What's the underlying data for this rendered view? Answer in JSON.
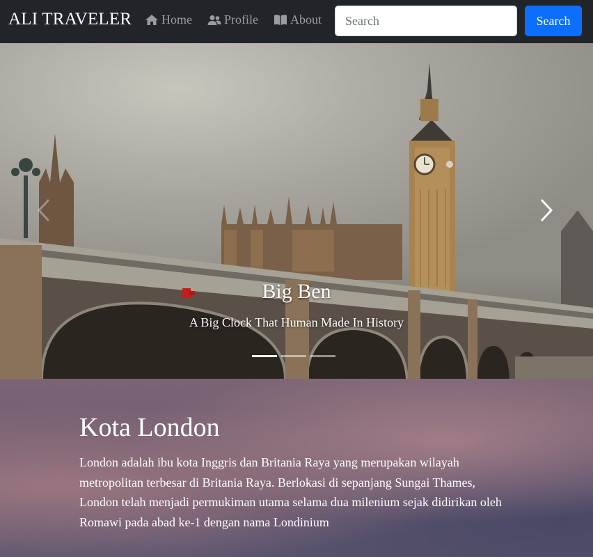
{
  "navbar": {
    "brand": "ALI TRAVELER",
    "items": [
      {
        "label": "Home",
        "icon": "home-icon"
      },
      {
        "label": "Profile",
        "icon": "users-icon"
      },
      {
        "label": "About",
        "icon": "book-icon"
      }
    ],
    "search": {
      "placeholder": "Search",
      "value": ""
    },
    "search_button": "Search",
    "colors": {
      "background": "#212529",
      "button": "#0d6efd"
    }
  },
  "carousel": {
    "caption_title": "Big Ben",
    "caption_text": "A Big Clock That Human Made In History",
    "slides_count": 3,
    "active_slide": 1,
    "prev_icon": "chevron-left-icon",
    "next_icon": "chevron-right-icon"
  },
  "content": {
    "title": "Kota London",
    "text": "London adalah ibu kota Inggris dan Britania Raya yang merupakan wilayah metropolitan terbesar di Britania Raya. Berlokasi di sepanjang Sungai Thames, London telah menjadi permukiman utama selama dua milenium sejak didirikan oleh Romawi pada abad ke-1 dengan nama Londinium"
  }
}
